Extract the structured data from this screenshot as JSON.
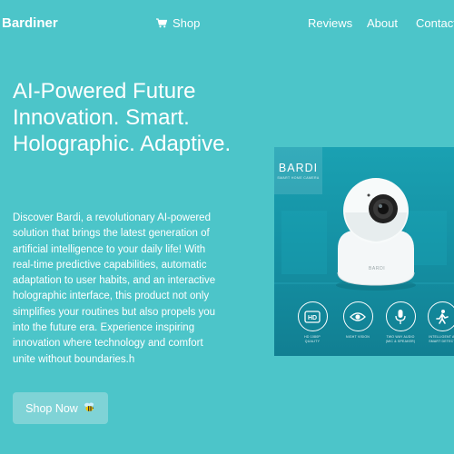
{
  "header": {
    "brand": "Bardiner",
    "nav": {
      "shop": "Shop",
      "reviews": "Reviews",
      "about": "About",
      "contact": "Contact"
    },
    "icons": {
      "shop": "cart-icon"
    }
  },
  "hero": {
    "headline": "AI-Powered Future Innovation. Smart. Holographic. Adaptive.",
    "description": "Discover Bardi, a revolutionary AI-powered solution that brings the latest generation of artificial intelligence to your daily life! With real-time predictive capabilities, automatic adaptation to user habits, and an interactive holographic interface, this product not only simplifies your routines but also propels you into the future era. Experience inspiring innovation where technology and comfort unite without boundaries.h",
    "cta": {
      "label": "Shop Now",
      "icon": "bee-icon"
    }
  },
  "product": {
    "brand": "BARDI",
    "brand_sub": "SMART HOME CAMERA",
    "camera_brand": "BARDI",
    "features": [
      {
        "icon": "hd-icon",
        "label": "HD 1080P\nQUALITY"
      },
      {
        "icon": "eye-icon",
        "label": "NIGHT VISION"
      },
      {
        "icon": "microphone-icon",
        "label": "TWO WAY AUDIO\n(MIC & SPEAKER)"
      },
      {
        "icon": "running-person-icon",
        "label": "INTELLIGENT AI\nSMART DETECT"
      }
    ]
  },
  "colors": {
    "background": "#4cc5c9",
    "button": "#7fd3d6",
    "product_bg": "#1592a5",
    "text": "#ffffff"
  }
}
